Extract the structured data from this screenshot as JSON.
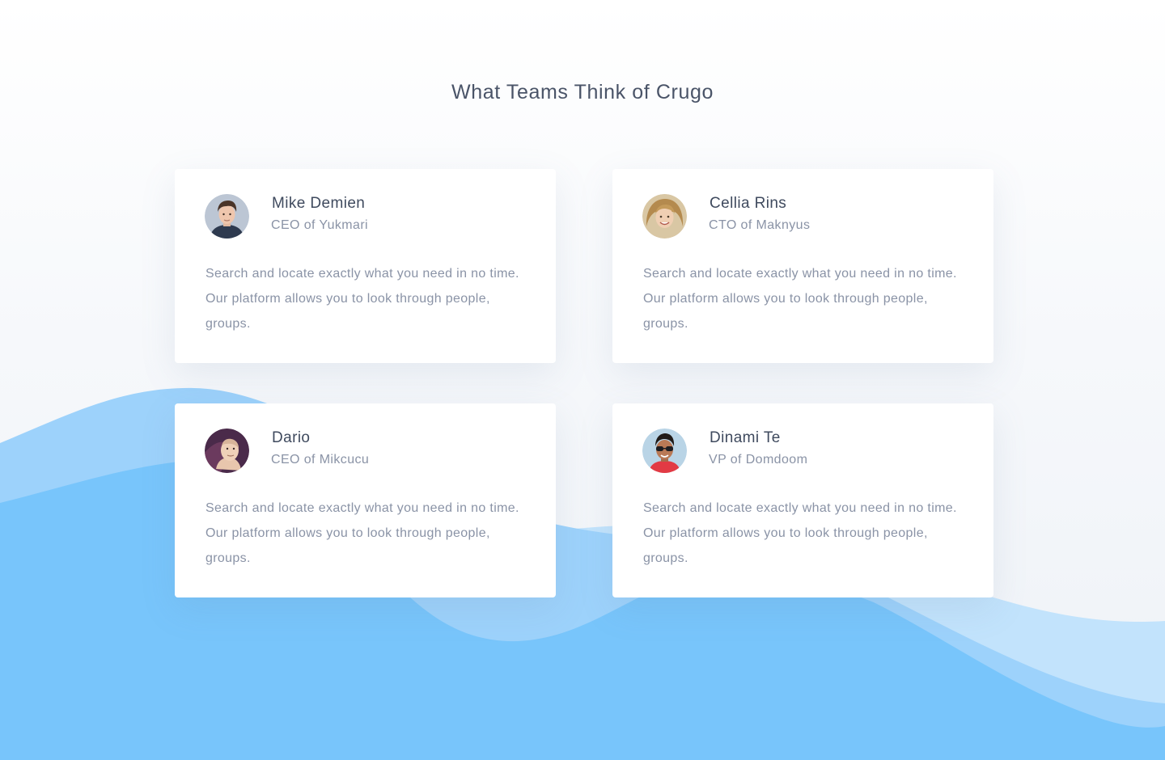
{
  "section": {
    "title": "What Teams Think of Crugo"
  },
  "testimonials": [
    {
      "name": "Mike Demien",
      "role": "CEO of Yukmari",
      "quote": "Search and locate exactly what you need in no time. Our platform allows you to look through people, groups."
    },
    {
      "name": "Cellia Rins",
      "role": "CTO of Maknyus",
      "quote": "Search and locate exactly what you need in no time. Our platform allows you to look through people, groups."
    },
    {
      "name": "Dario",
      "role": "CEO of Mikcucu",
      "quote": "Search and locate exactly what you need in no time. Our platform allows you to look through people, groups."
    },
    {
      "name": "Dinami Te",
      "role": "VP of Domdoom",
      "quote": "Search and locate exactly what you need in no time. Our platform allows you to look through people, groups."
    }
  ],
  "colors": {
    "title": "#4a5468",
    "name": "#3f4a5e",
    "muted_text": "#8a93a6",
    "wave_light": "#c2e3fc",
    "wave_mid": "#9dd2fb",
    "wave_main": "#78c5fb",
    "card_background": "#ffffff"
  }
}
